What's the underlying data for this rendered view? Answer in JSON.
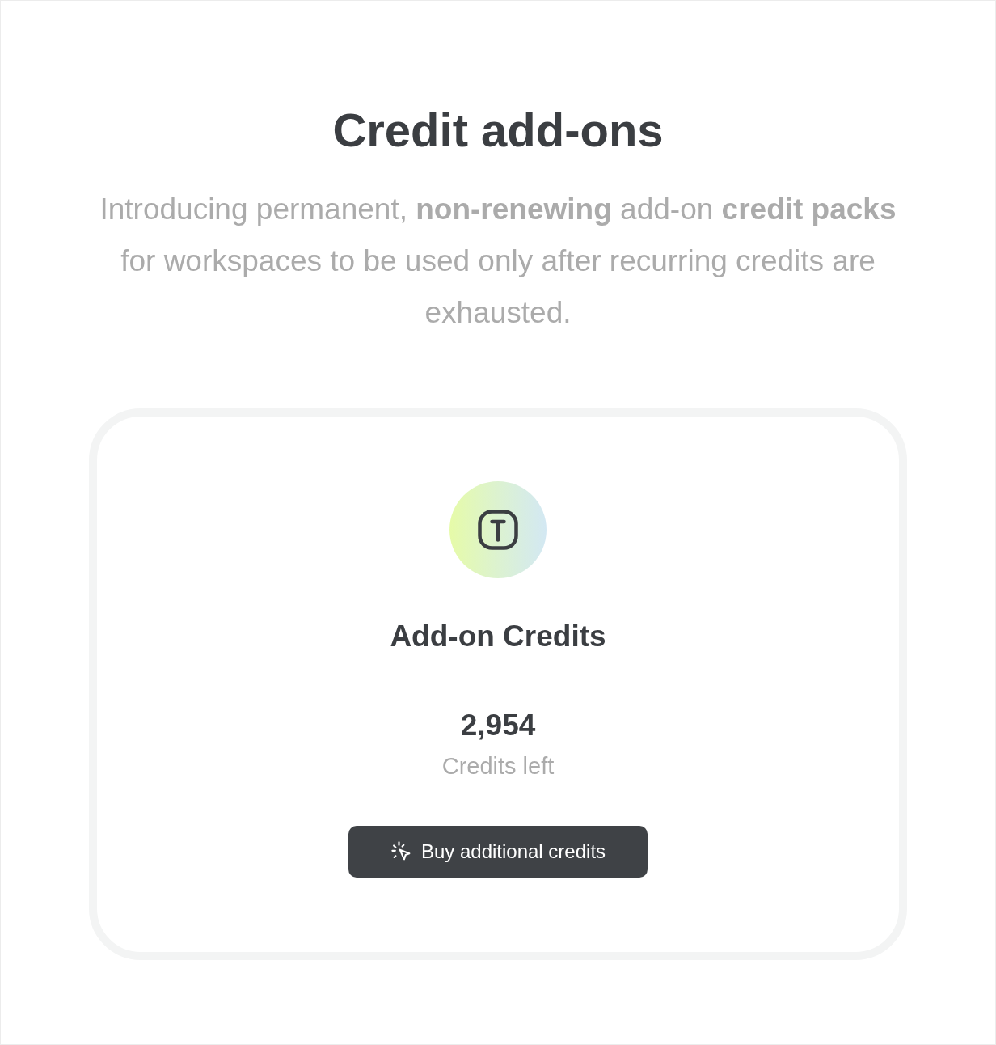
{
  "heading": "Credit add-ons",
  "description": "Introducing permanent, **non-renewing** add-on **credit packs** for workspaces to be used only after recurring credits are exhausted.",
  "card": {
    "title": "Add-on Credits",
    "value": "2,954",
    "value_label": "Credits left",
    "button": "Buy additional credits"
  }
}
